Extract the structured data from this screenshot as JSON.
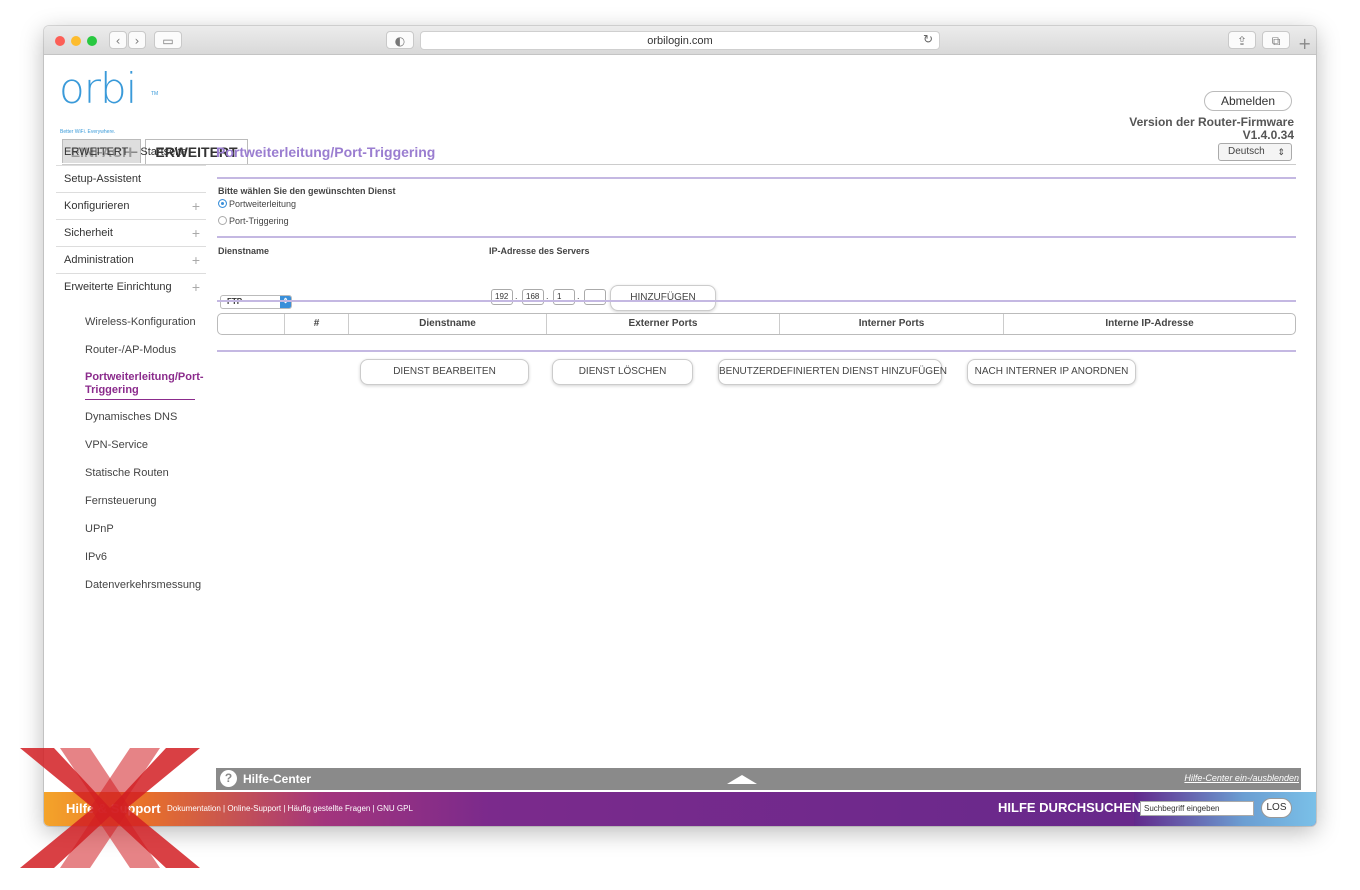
{
  "browser": {
    "url": "orbilogin.com"
  },
  "header": {
    "logo": "orbi",
    "logo_tm": "TM",
    "tagline": "Better WiFi. Everywhere.",
    "tabs": [
      {
        "label": "EINFACH"
      },
      {
        "label": "ERWEITERT"
      }
    ],
    "logout": "Abmelden",
    "firmware_label": "Version der Router-Firmware",
    "firmware_version": "V1.4.0.34",
    "language": "Deutsch"
  },
  "sidebar": {
    "top_items": [
      {
        "label": "ERWEITERT – Startseite"
      },
      {
        "label": "Setup-Assistent"
      },
      {
        "label": "Konfigurieren"
      },
      {
        "label": "Sicherheit"
      },
      {
        "label": "Administration"
      },
      {
        "label": "Erweiterte Einrichtung"
      }
    ],
    "sub_items": [
      {
        "label": "Wireless-Konfiguration"
      },
      {
        "label": "Router-/AP-Modus"
      },
      {
        "label": "Portweiterleitung/Port-Triggering"
      },
      {
        "label": "Dynamisches DNS"
      },
      {
        "label": "VPN-Service"
      },
      {
        "label": "Statische Routen"
      },
      {
        "label": "Fernsteuerung"
      },
      {
        "label": "UPnP"
      },
      {
        "label": "IPv6"
      },
      {
        "label": "Datenverkehrsmessung"
      }
    ]
  },
  "main": {
    "title": "Portweiterleitung/Port-Triggering",
    "service_prompt": "Bitte wählen Sie den gewünschten Dienst",
    "radios": [
      {
        "label": "Portweiterleitung",
        "checked": true
      },
      {
        "label": "Port-Triggering",
        "checked": false
      }
    ],
    "service_name_label": "Dienstname",
    "service_select": "FTP",
    "server_ip_label": "IP-Adresse des Servers",
    "ip_octets": [
      "192",
      "168",
      "1",
      ""
    ],
    "add_button": "HINZUFÜGEN",
    "table_columns": [
      "",
      "#",
      "Dienstname",
      "Externer Ports",
      "Interner Ports",
      "Interne IP-Adresse"
    ],
    "action_buttons": [
      "DIENST BEARBEITEN",
      "DIENST LÖSCHEN",
      "BENUTZERDEFINIERTEN DIENST HINZUFÜGEN",
      "NACH INTERNER IP ANORDNEN"
    ]
  },
  "help": {
    "title": "Hilfe-Center",
    "toggle": "Hilfe-Center ein-/ausblenden"
  },
  "footer": {
    "title": "Hilfe & Support",
    "links": "Dokumentation | Online-Support | Häufig gestellte Fragen | GNU GPL",
    "search_label": "HILFE DURCHSUCHEN",
    "search_placeholder": "Suchbegriff eingeben",
    "go": "LOS"
  },
  "colors": {
    "accent": "#9a7dd0",
    "link_active": "#8b2b8c",
    "brand_blue": "#3a9ad9"
  }
}
